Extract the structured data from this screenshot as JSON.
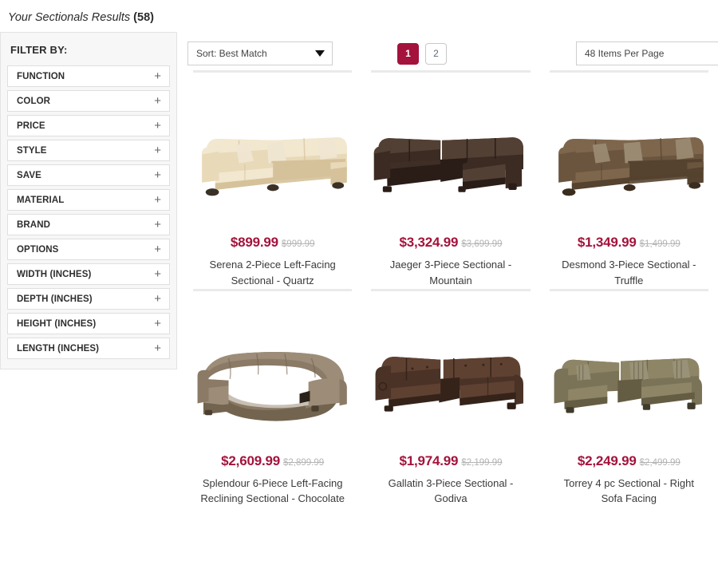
{
  "header": {
    "phrase": "Your Sectionals Results",
    "count": "(58)"
  },
  "sidebar": {
    "title": "FILTER BY:",
    "expand_icon": "+",
    "items": [
      {
        "label": "FUNCTION"
      },
      {
        "label": "COLOR"
      },
      {
        "label": "PRICE"
      },
      {
        "label": "STYLE"
      },
      {
        "label": "SAVE"
      },
      {
        "label": "MATERIAL"
      },
      {
        "label": "BRAND"
      },
      {
        "label": "OPTIONS"
      },
      {
        "label": "WIDTH (INCHES)"
      },
      {
        "label": "DEPTH (INCHES)"
      },
      {
        "label": "HEIGHT (INCHES)"
      },
      {
        "label": "LENGTH (INCHES)"
      }
    ]
  },
  "toolbar": {
    "sort": {
      "value": "Sort: Best Match"
    },
    "per_page": {
      "value": "48 Items Per Page"
    },
    "pagination": {
      "pages": [
        {
          "label": "1",
          "active": true
        },
        {
          "label": "2",
          "active": false
        }
      ]
    }
  },
  "colors": {
    "accent": "#a4133c",
    "old_price": "#b4b4b4",
    "separator": "#eaeaea",
    "sidebar_bg": "#f7f7f7"
  },
  "products": [
    {
      "price": "$899.99",
      "old_price": "$999.99",
      "title": "Serena 2-Piece Left-Facing Sectional - Quartz",
      "image_name": "cream-l-shaped-sectional",
      "body": "#e8d9b8",
      "body_dark": "#d6c29a",
      "body_light": "#f2e7cf",
      "leg": "#3a3026",
      "pillow": "#efe6d2"
    },
    {
      "price": "$3,324.99",
      "old_price": "$3,699.99",
      "title": "Jaeger 3-Piece Sectional - Mountain",
      "image_name": "dark-brown-leather-sectional",
      "body": "#3b2b23",
      "body_dark": "#2a1d17",
      "body_light": "#534034",
      "leg": "#2a1d17",
      "pillow": "#4a372c"
    },
    {
      "price": "$1,349.99",
      "old_price": "$1,499.99",
      "title": "Desmond 3-Piece Sectional - Truffle",
      "image_name": "truffle-fabric-sectional",
      "body": "#6b553f",
      "body_dark": "#55422f",
      "body_light": "#7e664d",
      "leg": "#3a2c1e",
      "pillow": "#9b8a72"
    },
    {
      "price": "$2,609.99",
      "old_price": "$2,899.99",
      "title": "Splendour 6-Piece Left-Facing Reclining Sectional - Chocolate",
      "image_name": "taupe-curved-reclining-sectional",
      "body": "#8a7a66",
      "body_dark": "#73644f",
      "body_light": "#9d8d78",
      "leg": "#4a3f31",
      "pillow": "#9d8d78"
    },
    {
      "price": "$1,974.99",
      "old_price": "$2,199.99",
      "title": "Gallatin 3-Piece Sectional - Godiva",
      "image_name": "chocolate-leather-reclining-sectional",
      "body": "#4a3226",
      "body_dark": "#35231a",
      "body_light": "#5f4132",
      "leg": "#2d1e16",
      "pillow": "#5f4132"
    },
    {
      "price": "$2,249.99",
      "old_price": "$2,499.99",
      "title": "Torrey 4 pc Sectional - Right Sofa Facing",
      "image_name": "olive-green-sectional",
      "body": "#7b7357",
      "body_dark": "#645d44",
      "body_light": "#8d8566",
      "leg": "#3f3a2a",
      "pillow": "#9a9278"
    }
  ]
}
